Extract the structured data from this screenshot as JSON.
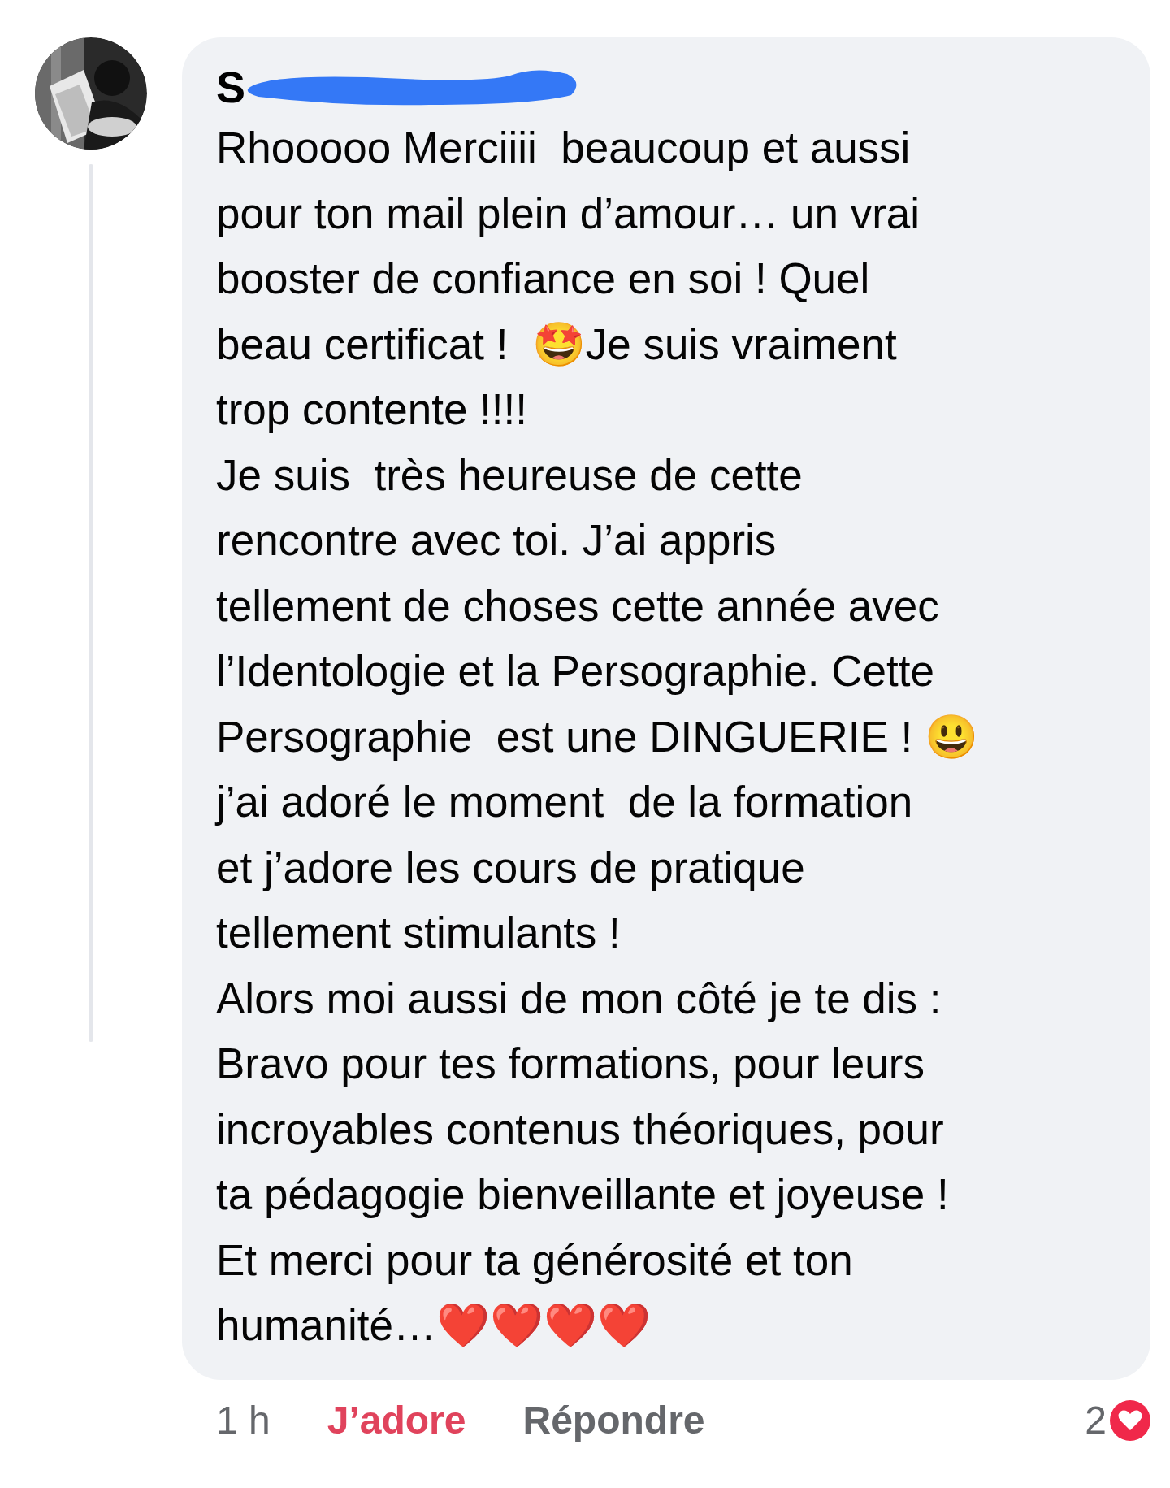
{
  "comment": {
    "author": "S",
    "lines": [
      "Rhooooo Merciiii  beaucoup et aussi",
      "pour ton mail plein d’amour… un vrai",
      "booster de confiance en soi ! Quel",
      "beau certificat !  🤩Je suis vraiment",
      "trop contente !!!!",
      "Je suis  très heureuse de cette",
      "rencontre avec toi. J’ai appris",
      "tellement de choses cette année avec",
      "l’Identologie et la Persographie. Cette",
      "Persographie  est une DINGUERIE ! 😃",
      "j’ai adoré le moment  de la formation",
      "et j’adore les cours de pratique",
      "tellement stimulants !",
      "Alors moi aussi de mon côté je te dis :",
      "Bravo pour tes formations, pour leurs",
      "incroyables contenus théoriques, pour",
      "ta pédagogie bienveillante et joyeuse !",
      "Et merci pour ta générosité et ton",
      "humanité…❤️❤️❤️❤️"
    ],
    "time": "1 h",
    "react": {
      "label": "J’adore",
      "selected": true
    },
    "reply": "Répondre",
    "reaction_count": "2"
  }
}
